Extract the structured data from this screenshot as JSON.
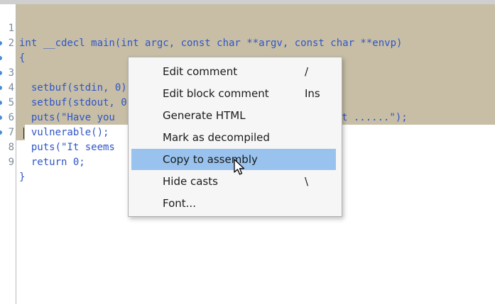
{
  "editor": {
    "lines": [
      {
        "num": "1",
        "text": "int __cdecl main(int argc, const char **argv, const char **envp)",
        "bp": false
      },
      {
        "num": "2",
        "text": "{",
        "bp": false
      },
      {
        "num": "3",
        "text": "  setbuf(stdin, 0);",
        "bp": true
      },
      {
        "num": "4",
        "text": "  setbuf(stdout, 0);",
        "bp": true
      },
      {
        "num": "5",
        "text": "  puts(\"Have you",
        "bp": true
      },
      {
        "num": "6",
        "text": "  vulnerable();",
        "bp": true
      },
      {
        "num": "7",
        "text": "  puts(\"It seems",
        "bp": true
      },
      {
        "num": "7",
        "text": "t ......\");",
        "bp": false
      },
      {
        "num": "8",
        "text": "  return 0;",
        "bp": true
      },
      {
        "num": "9",
        "text": "}",
        "bp": true
      }
    ]
  },
  "context_menu": {
    "items": [
      {
        "label": "Edit comment",
        "shortcut": "/"
      },
      {
        "label": "Edit block comment",
        "shortcut": "Ins"
      },
      {
        "label": "Generate HTML",
        "shortcut": ""
      },
      {
        "label": "Mark as decompiled",
        "shortcut": ""
      },
      {
        "label": "Copy to assembly",
        "shortcut": "",
        "highlighted": true
      },
      {
        "label": "Hide casts",
        "shortcut": "\\"
      },
      {
        "label": "Font...",
        "shortcut": ""
      }
    ]
  },
  "colors": {
    "selection": "#c7bea5",
    "code_text": "#2f55c8",
    "menu_highlight": "#99c3ee",
    "breakpoint_dot": "#4a8bd6"
  }
}
